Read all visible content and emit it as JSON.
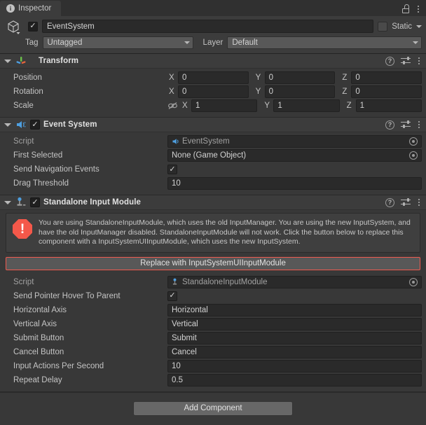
{
  "tab": {
    "label": "Inspector",
    "info_icon": "info-icon",
    "lock_icon": "lock-icon",
    "menu_icon": "kebab-menu-icon"
  },
  "game_object": {
    "icon": "cube-icon",
    "enabled": true,
    "check_glyph": "✓",
    "name": "EventSystem",
    "static_label": "Static",
    "static_checked": false,
    "tag_label": "Tag",
    "tag_value": "Untagged",
    "layer_label": "Layer",
    "layer_value": "Default"
  },
  "components": [
    {
      "title": "Transform",
      "icon": "transform-gizmo-icon",
      "has_toggle": false,
      "help_icon": "help-icon",
      "preset_icon": "preset-sliders-icon",
      "menu_icon": "kebab-menu-icon",
      "vectors": [
        {
          "label": "Position",
          "x": "0",
          "y": "0",
          "z": "0",
          "link_icon": null
        },
        {
          "label": "Rotation",
          "x": "0",
          "y": "0",
          "z": "0",
          "link_icon": null
        },
        {
          "label": "Scale",
          "x": "1",
          "y": "1",
          "z": "1",
          "link_icon": "unlinked-scale-icon"
        }
      ],
      "axis_labels": {
        "x": "X",
        "y": "Y",
        "z": "Z"
      }
    },
    {
      "title": "Event System",
      "icon": "event-system-icon",
      "has_toggle": true,
      "enabled": true,
      "check_glyph": "✓",
      "help_icon": "help-icon",
      "preset_icon": "preset-sliders-icon",
      "menu_icon": "kebab-menu-icon",
      "properties": [
        {
          "label": "Script",
          "type": "object",
          "value": "EventSystem",
          "dim": true,
          "icon": "event-system-icon",
          "picker": true
        },
        {
          "label": "First Selected",
          "type": "object",
          "value": "None (Game Object)",
          "dim": false,
          "picker": true
        },
        {
          "label": "Send Navigation Events",
          "type": "checkbox",
          "checked": true,
          "check_glyph": "✓"
        },
        {
          "label": "Drag Threshold",
          "type": "text",
          "value": "10"
        }
      ]
    },
    {
      "title": "Standalone Input Module",
      "icon": "joystick-icon",
      "has_toggle": true,
      "enabled": true,
      "check_glyph": "✓",
      "help_icon": "help-icon",
      "preset_icon": "preset-sliders-icon",
      "menu_icon": "kebab-menu-icon",
      "warning": {
        "icon": "error-octagon-icon",
        "glyph": "!",
        "color": "#f4584a",
        "text": "You are using StandaloneInputModule, which uses the old InputManager. You are using the new InputSystem, and have the old InputManager disabled. StandaloneInputModule will not work. Click the button below to replace this component with a InputSystemUIInputModule, which uses the new InputSystem."
      },
      "replace_button": {
        "label": "Replace with InputSystemUIInputModule",
        "border_color": "#f05a4f"
      },
      "properties": [
        {
          "label": "Script",
          "type": "object",
          "value": "StandaloneInputModule",
          "dim": true,
          "icon": "joystick-icon",
          "picker": true
        },
        {
          "label": "Send Pointer Hover To Parent",
          "type": "checkbox",
          "checked": true,
          "check_glyph": "✓"
        },
        {
          "label": "Horizontal Axis",
          "type": "text",
          "value": "Horizontal"
        },
        {
          "label": "Vertical Axis",
          "type": "text",
          "value": "Vertical"
        },
        {
          "label": "Submit Button",
          "type": "text",
          "value": "Submit"
        },
        {
          "label": "Cancel Button",
          "type": "text",
          "value": "Cancel"
        },
        {
          "label": "Input Actions Per Second",
          "type": "text",
          "value": "10"
        },
        {
          "label": "Repeat Delay",
          "type": "text",
          "value": "0.5"
        }
      ]
    }
  ],
  "footer": {
    "add_component_label": "Add Component"
  },
  "colors": {
    "background": "#383838",
    "panel": "#3c3c3c",
    "field": "#2a2a2a",
    "dropdown": "#585858",
    "error": "#f4584a",
    "accent_blue": "#4e9fe0"
  }
}
